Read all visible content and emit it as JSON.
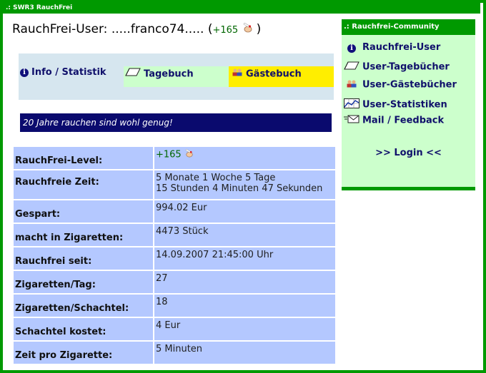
{
  "window": {
    "title": ".: SWR3 RauchFrei"
  },
  "header": {
    "user_label": "RauchFrei-User:",
    "username": ".....franco74.....",
    "paren_open": "(",
    "level": "+165",
    "paren_close": ")"
  },
  "tabs": [
    {
      "label": "Info / Statistik",
      "icon": "info-icon"
    },
    {
      "label": "Tagebuch",
      "icon": "eraser-icon"
    },
    {
      "label": "Gästebuch",
      "icon": "people-icon"
    }
  ],
  "motto": "20 Jahre rauchen sind wohl genug!",
  "stats": [
    {
      "label": "RauchFrei-Level:",
      "value": "+165"
    },
    {
      "label": "Rauchfreie Zeit:",
      "value": "5 Monate 1 Woche 5 Tage",
      "value2": "15 Stunden 4 Minuten 47 Sekunden"
    },
    {
      "label": "Gespart:",
      "value": "994.02 Eur"
    },
    {
      "label": "macht in Zigaretten:",
      "value": "4473 Stück"
    },
    {
      "label": "Rauchfrei seit:",
      "value": "14.09.2007 21:45:00 Uhr"
    },
    {
      "label": "Zigaretten/Tag:",
      "value": "27"
    },
    {
      "label": "Zigaretten/Schachtel:",
      "value": "18"
    },
    {
      "label": "Schachtel kostet:",
      "value": "4 Eur"
    },
    {
      "label": "Zeit pro Zigarette:",
      "value": "5 Minuten"
    }
  ],
  "community": {
    "title": ".: Rauchfrei-Community",
    "items": [
      {
        "label": "Rauchfrei-User",
        "icon": "info-icon"
      },
      {
        "label": "User-Tagebücher",
        "icon": "eraser-icon"
      },
      {
        "label": "User-Gästebücher",
        "icon": "people-icon"
      },
      {
        "label": "User-Statistiken",
        "icon": "chart-icon"
      },
      {
        "label": "Mail / Feedback",
        "icon": "mail-icon"
      }
    ],
    "login": ">> Login <<"
  },
  "colors": {
    "brand_green": "#009900",
    "light_green": "#ccffcc",
    "navy": "#0a0a6e",
    "table_blue": "#b4c8ff",
    "tab_yellow": "#ffee00"
  }
}
